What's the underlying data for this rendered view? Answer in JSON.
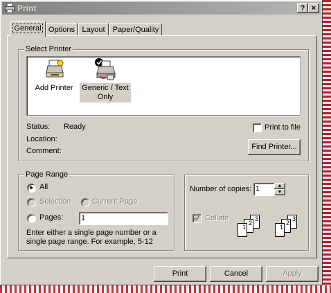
{
  "window": {
    "title": "Print",
    "help_btn": "?",
    "close_btn": "×"
  },
  "tabs": [
    {
      "label": "General",
      "active": true
    },
    {
      "label": "Options"
    },
    {
      "label": "Layout"
    },
    {
      "label": "Paper/Quality"
    }
  ],
  "select_printer": {
    "legend": "Select Printer",
    "printers": [
      {
        "label": "Add Printer",
        "icon": "add-printer-icon"
      },
      {
        "label": "Generic / Text Only",
        "icon": "printer-icon",
        "selected": true
      }
    ],
    "status_label": "Status:",
    "status_value": "Ready",
    "location_label": "Location:",
    "location_value": "",
    "comment_label": "Comment:",
    "comment_value": "",
    "print_to_file": "Print to file",
    "find_printer": "Find Printer..."
  },
  "page_range": {
    "legend": "Page Range",
    "all": "All",
    "selection": "Selection",
    "current_page": "Current Page",
    "pages": "Pages:",
    "pages_value": "1",
    "hint": "Enter either a single page number or a single page range.  For example, 5-12"
  },
  "copies": {
    "label": "Number of copies:",
    "value": "1",
    "collate": "Collate",
    "collate_checked": true,
    "page_numbers": [
      "1",
      "2",
      "3"
    ]
  },
  "buttons": {
    "print": "Print",
    "cancel": "Cancel",
    "apply": "Apply"
  }
}
